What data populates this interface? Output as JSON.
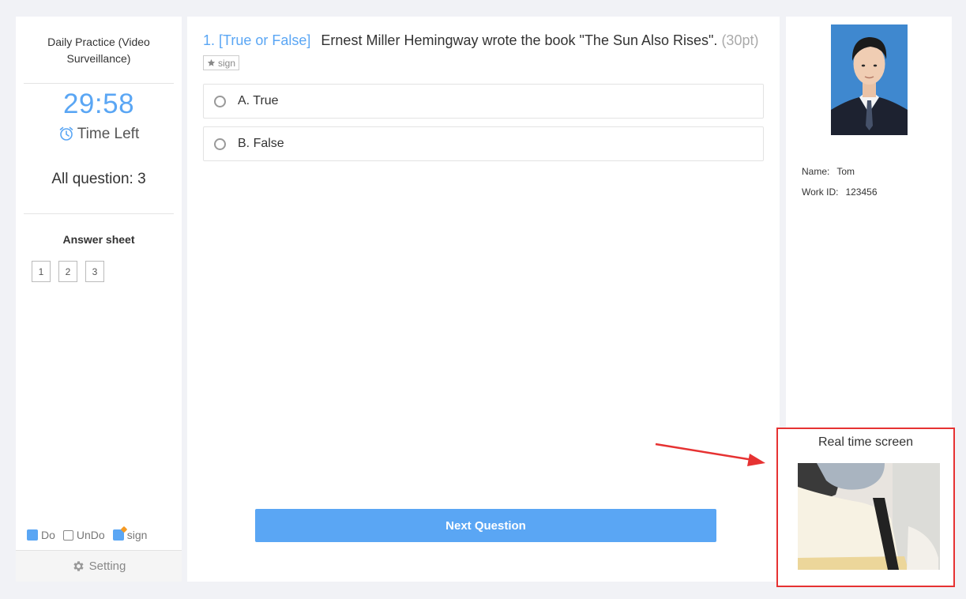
{
  "left": {
    "exam_title": "Daily Practice (Video Surveillance)",
    "timer": "29:58",
    "time_left_label": "Time Left",
    "all_questions": "All question: 3",
    "answer_sheet_title": "Answer sheet",
    "answer_sheet_items": [
      "1",
      "2",
      "3"
    ],
    "legend": {
      "do": "Do",
      "undo": "UnDo",
      "sign": "sign"
    },
    "setting_label": "Setting"
  },
  "question": {
    "number": "1.",
    "type": "[True or False]",
    "text": "Ernest Miller Hemingway wrote the book \"The Sun Also Rises\".",
    "points": "(30pt)",
    "sign_tag": "sign",
    "options": [
      {
        "label": "A. True"
      },
      {
        "label": "B. False"
      }
    ],
    "next_button": "Next Question"
  },
  "profile": {
    "name_label": "Name:",
    "name_value": "Tom",
    "work_id_label": "Work ID:",
    "work_id_value": "123456"
  },
  "realtime": {
    "title": "Real time screen"
  },
  "colors": {
    "accent": "#5aa6f4",
    "highlight_border": "#e63232"
  }
}
